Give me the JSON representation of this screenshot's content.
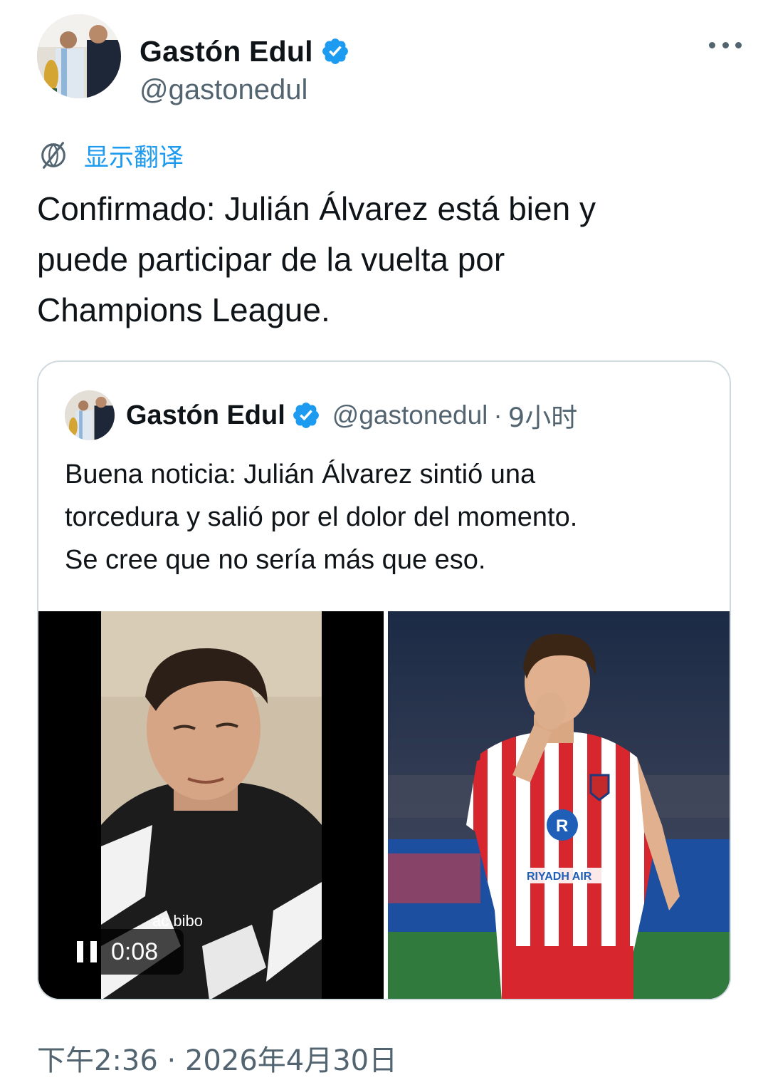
{
  "tweet": {
    "author_name": "Gastón Edul",
    "author_handle": "@gastonedul",
    "translate_label": "显示翻译",
    "text": "Confirmado: Julián Álvarez está bien y\npuede participar de la vuelta por\nChampions League.",
    "timestamp": "下午2:36 · 2026年4月30日"
  },
  "quoted": {
    "author_name": "Gastón Edul",
    "author_handle": "@gastonedul",
    "separator": "·",
    "relative_time": "9小时",
    "text": "Buena noticia: Julián Álvarez sintió una\ntorcedura y salió por el dolor del momento.\nSe cree que no sería más que eso.",
    "video": {
      "elapsed": "0:08",
      "state": "playing",
      "hoodie_text": "ac bibo"
    },
    "photo": {
      "sponsor_text": "RIYADH AIR"
    }
  },
  "colors": {
    "accent": "#1d9bf0",
    "text_primary": "#0f1419",
    "text_secondary": "#536471",
    "border": "#cfd9de",
    "jersey_red": "#d8262f"
  },
  "icons": [
    "verified-badge-icon",
    "more-options-icon",
    "translate-icon",
    "pause-icon"
  ]
}
